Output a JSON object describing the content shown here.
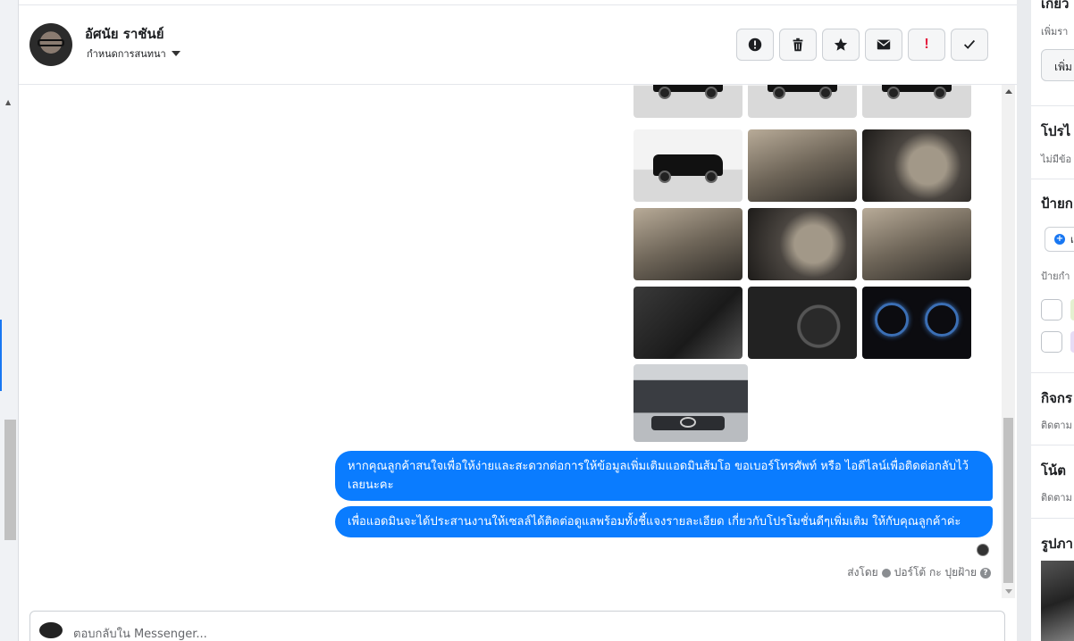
{
  "header": {
    "contact_name": "อัศนัย ราชันย์",
    "assign_label": "กำหนดการสนทนา",
    "actions": [
      {
        "icon": "alert-circle-icon",
        "name": "mark-spam-button"
      },
      {
        "icon": "trash-icon",
        "name": "delete-button"
      },
      {
        "icon": "star-icon",
        "name": "star-button"
      },
      {
        "icon": "envelope-icon",
        "name": "mark-unread-button"
      },
      {
        "icon": "exclamation-icon",
        "name": "follow-up-button",
        "glyph": "!"
      },
      {
        "icon": "check-icon",
        "name": "mark-done-button"
      }
    ]
  },
  "conversation": {
    "messages": [
      {
        "text": "หากคุณลูกค้าสนใจเพื่อให้ง่ายและสะดวกต่อการให้ข้อมูลเพิ่มเติมแอดมินส้มโอ ขอเบอร์โทรศัพท์ หรือ ไอดีไลน์เพื่อติดต่อกลับไว้เลยนะคะ"
      },
      {
        "text": "เพื่อแอดมินจะได้ประสานงานให้เซลล์ได้ติดต่อดูแลพร้อมทั้งชี้แจงรายละเอียด เกี่ยวกับโปรโมชั่นดีๆเพิ่มเติม ให้กับคุณลูกค้าค่ะ"
      }
    ],
    "sent_by_prefix": "ส่งโดย",
    "sent_by_name": "ปอร์โต้ กะ ปุยฝ้าย",
    "help_glyph": "?"
  },
  "reply": {
    "placeholder": "ตอบกลับใน Messenger..."
  },
  "side_panel": {
    "top_title": "เกี่ยว",
    "top_sub": "เพิ่มรา",
    "top_button": "เพิ่ม",
    "profile_title": "โปรไ",
    "profile_sub": "ไม่มีข้อ",
    "labels_title": "ป้ายก",
    "add_label": "เ",
    "labels_sub": "ป้ายกำ",
    "activity_title": "กิจกร",
    "activity_sub": "ติดตาม",
    "notes_title": "โน้ต",
    "notes_sub": "ติดตาม",
    "photos_title": "รูปภา"
  },
  "colors": {
    "bubble": "#0a7cff",
    "accent": "#1877f2",
    "follow_up": "#e41e3f"
  }
}
